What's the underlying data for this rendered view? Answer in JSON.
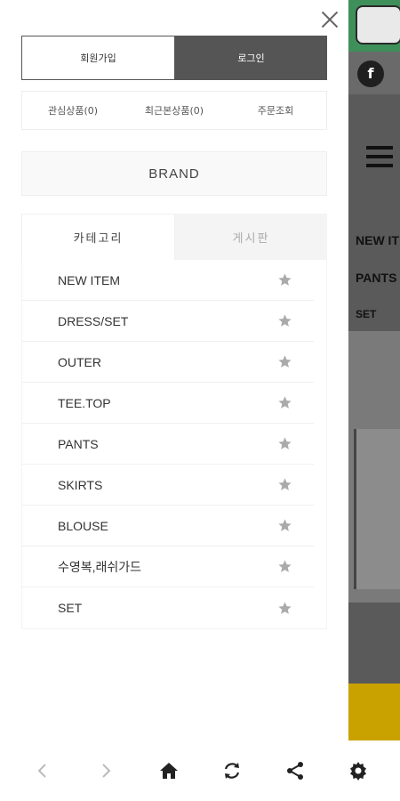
{
  "background": {
    "facebook_letter": "f",
    "nav_items": [
      "NEW IT",
      "PANTS",
      "SET"
    ]
  },
  "drawer": {
    "auth": {
      "join_label": "회원가입",
      "login_label": "로그인"
    },
    "quick_links": [
      {
        "label": "관심상품(0)"
      },
      {
        "label": "최근본상품(0)"
      },
      {
        "label": "주문조회"
      }
    ],
    "brand_label": "BRAND",
    "tabs": [
      {
        "label": "카테고리",
        "active": true
      },
      {
        "label": "게시판",
        "active": false
      }
    ],
    "categories": [
      {
        "label": "NEW ITEM"
      },
      {
        "label": "DRESS/SET"
      },
      {
        "label": "OUTER"
      },
      {
        "label": "TEE.TOP"
      },
      {
        "label": "PANTS"
      },
      {
        "label": "SKIRTS"
      },
      {
        "label": "BLOUSE"
      },
      {
        "label": "수영복,래쉬가드"
      },
      {
        "label": "SET"
      }
    ]
  },
  "bottom_bar": {
    "buttons": [
      "back-icon",
      "forward-icon",
      "home-icon",
      "refresh-icon",
      "share-icon",
      "settings-icon"
    ]
  },
  "colors": {
    "login_bg": "#555555",
    "star": "#aaaaaa",
    "inactive_tab_bg": "#f4f4f4"
  }
}
